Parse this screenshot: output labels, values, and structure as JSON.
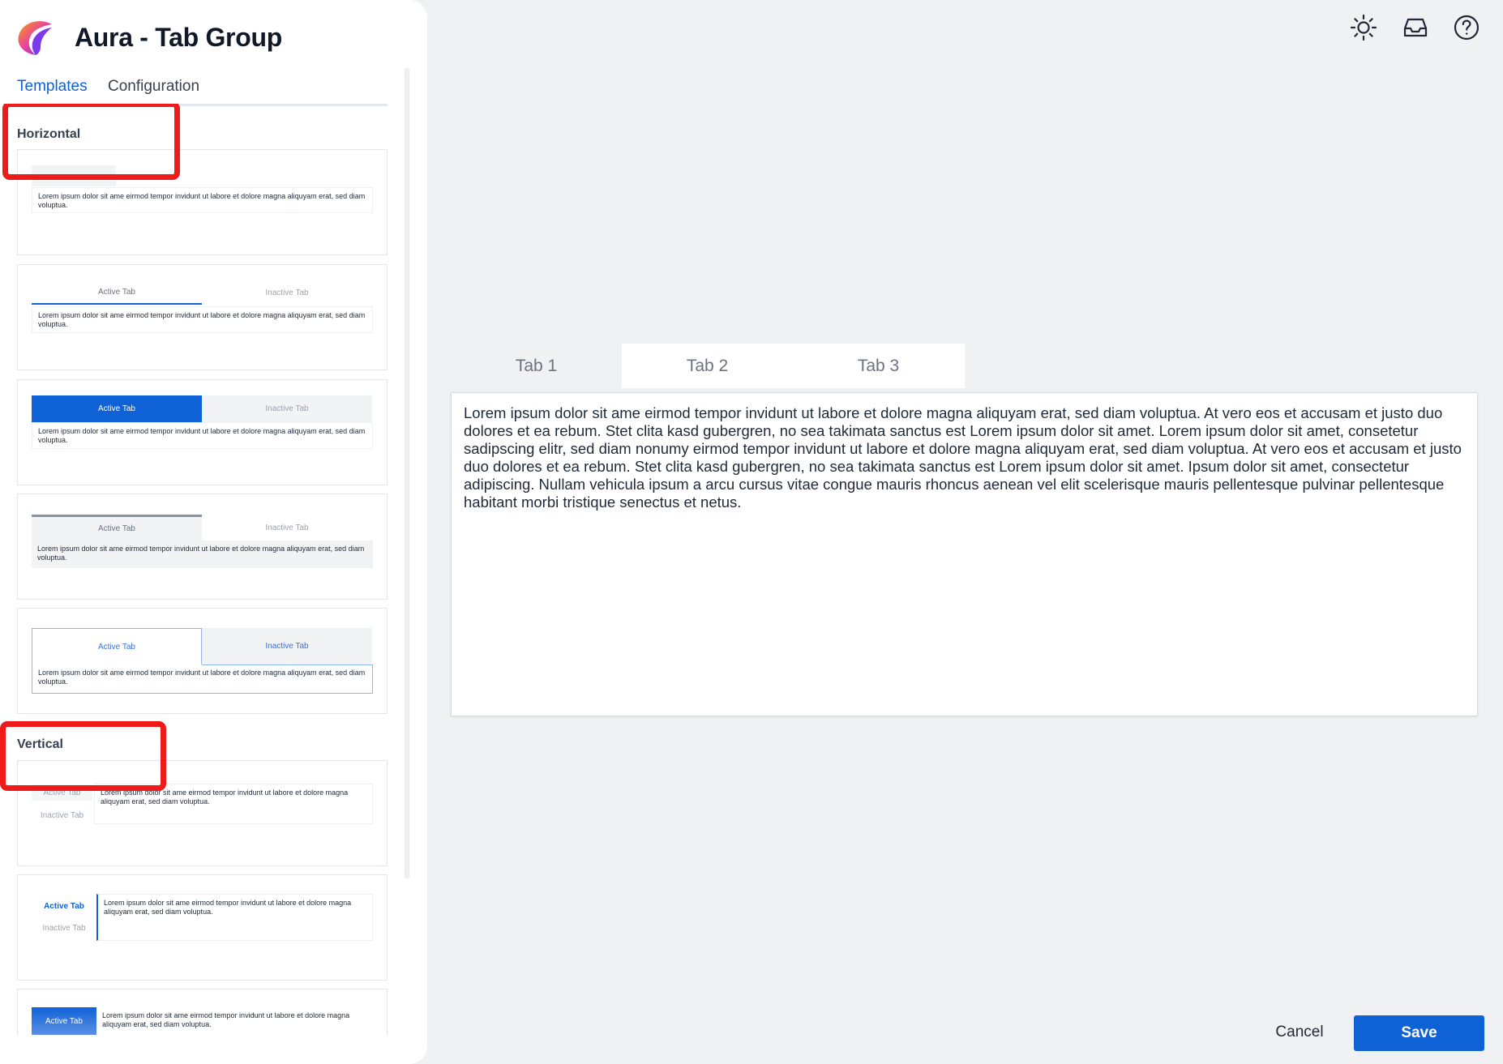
{
  "app": {
    "title": "Aura - Tab Group"
  },
  "sidebar": {
    "tabs": [
      {
        "label": "Templates",
        "active": true
      },
      {
        "label": "Configuration",
        "active": false
      }
    ],
    "sections": {
      "horizontal": "Horizontal",
      "vertical": "Vertical"
    },
    "templates": {
      "active_tab": "Active Tab",
      "inactive_tab": "Inactive Tab",
      "content": "Lorem ipsum dolor sit ame eirmod tempor invidunt ut labore et dolore magna aliquyam erat, sed diam voluptua."
    }
  },
  "preview": {
    "tabs": [
      {
        "label": "Tab 1",
        "selected": true
      },
      {
        "label": "Tab 2",
        "selected": false
      },
      {
        "label": "Tab 3",
        "selected": false
      }
    ],
    "content": "Lorem ipsum dolor sit ame eirmod tempor invidunt ut labore et dolore magna aliquyam erat, sed diam voluptua. At vero eos et accusam et justo duo dolores et ea rebum. Stet clita kasd gubergren, no sea takimata sanctus est Lorem ipsum dolor sit amet. Lorem ipsum dolor sit amet, consetetur sadipscing elitr, sed diam nonumy eirmod tempor invidunt ut labore et dolore magna aliquyam erat, sed diam voluptua. At vero eos et accusam et justo duo dolores et ea rebum. Stet clita kasd gubergren, no sea takimata sanctus est Lorem ipsum dolor sit amet. Ipsum dolor sit amet, consectetur adipiscing. Nullam vehicula ipsum a arcu cursus vitae congue mauris rhoncus aenean vel elit scelerisque mauris pellentesque pulvinar pellentesque habitant morbi tristique senectus et netus."
  },
  "toolbar": {
    "icons": [
      "sun-icon",
      "inbox-icon",
      "help-icon"
    ]
  },
  "footer": {
    "cancel_label": "Cancel",
    "save_label": "Save"
  },
  "colors": {
    "accent": "#0f62d6",
    "highlight": "#ef1b1b",
    "background": "#eff1f3"
  }
}
